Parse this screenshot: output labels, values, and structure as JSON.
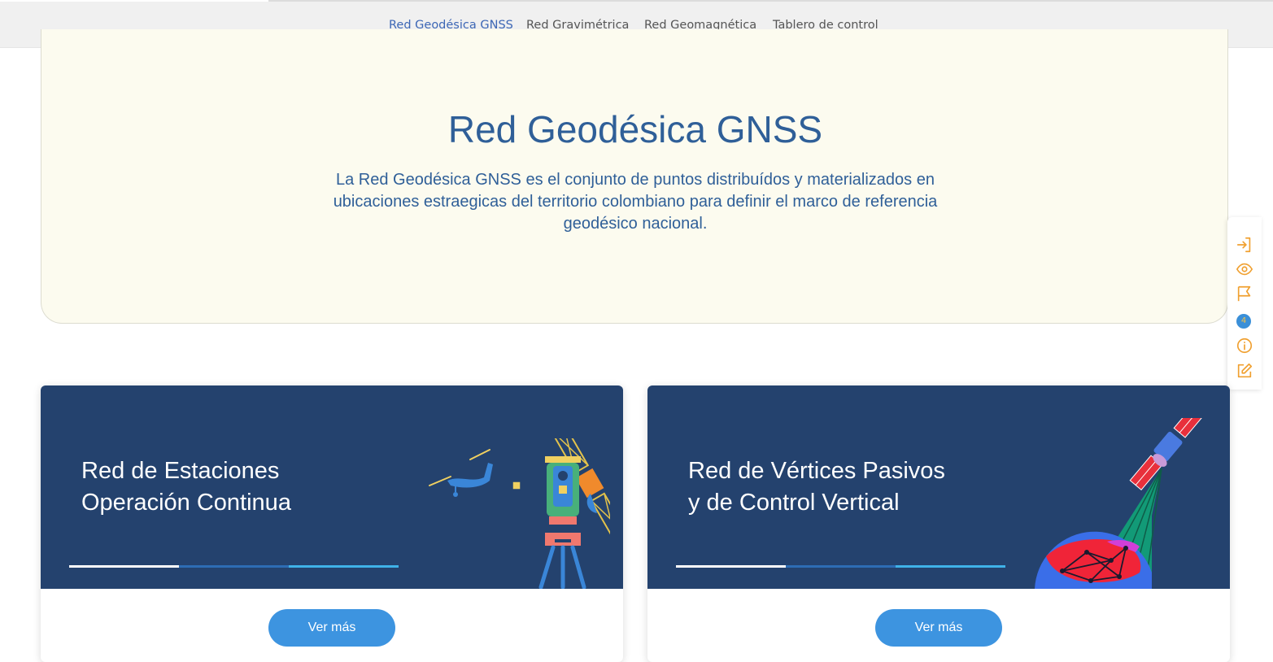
{
  "nav": {
    "items": [
      {
        "label": "Red Geodésica GNSS",
        "active": true
      },
      {
        "label": "Red Gravimétrica",
        "active": false
      },
      {
        "label": "Red Geomagnética",
        "active": false
      },
      {
        "label": "Tablero de control",
        "active": false
      }
    ]
  },
  "hero": {
    "title": "Red Geodésica GNSS",
    "description": "La Red Geodésica GNSS es el conjunto de puntos distribuídos y materializados en ubicaciones estraegicas del territorio colombiano para definir el marco de referencia geodésico nacional."
  },
  "sidebar": {
    "icons": [
      "login-icon",
      "eye-icon",
      "flag-icon",
      "badge",
      "info-icon",
      "edit-icon"
    ],
    "badge_count": "4",
    "icon_color": "#f0a030"
  },
  "cards": [
    {
      "title_line1": "Red de Estaciones",
      "title_line2": "Operación Continua",
      "button_label": "Ver más",
      "illustration": "surveying-instruments-drone-satellite"
    },
    {
      "title_line1": "Red de Vértices Pasivos",
      "title_line2": "y de Control Vertical",
      "button_label": "Ver más",
      "illustration": "satellite-beaming-globe-network"
    }
  ],
  "colors": {
    "nav_active": "#3d67b5",
    "hero_text": "#2f5f98",
    "card_banner": "#24426e",
    "button": "#3d94e0"
  }
}
